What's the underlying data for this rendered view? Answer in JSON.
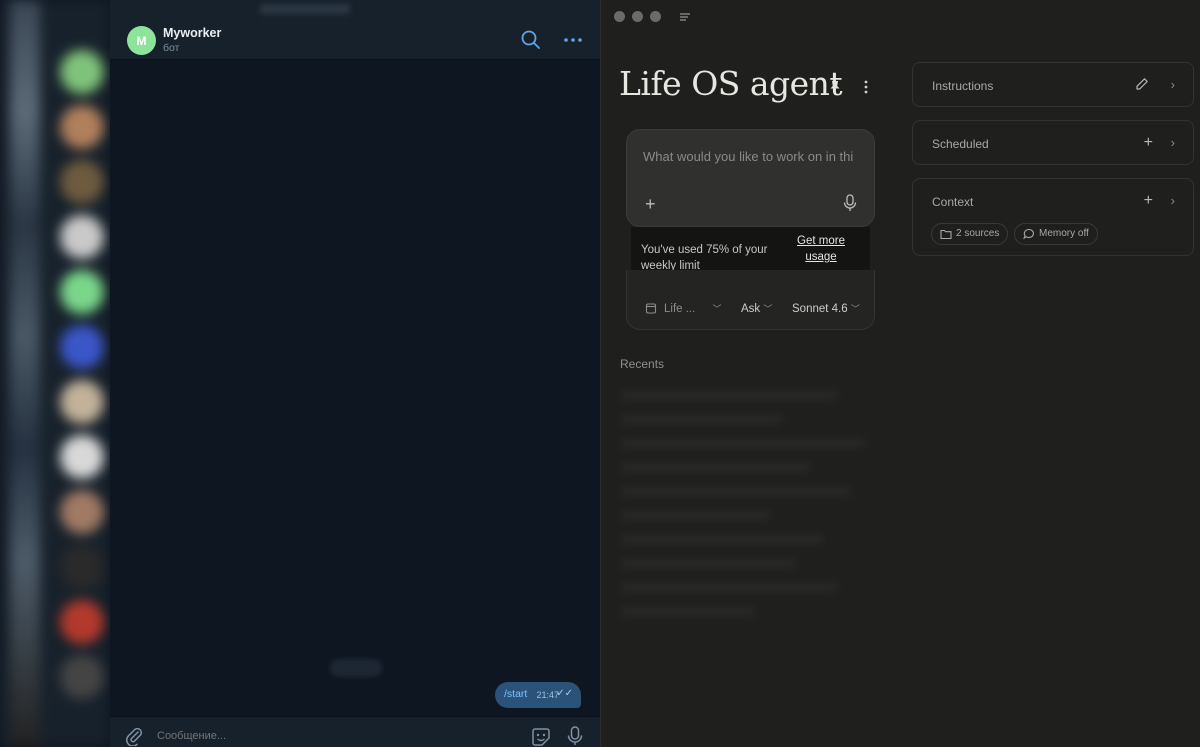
{
  "telegram": {
    "chat_name": "Myworker",
    "chat_subtitle": "бот",
    "avatar_letter": "M",
    "avatar_color": "#8ee39b",
    "message_text": "/start",
    "message_time": "21:47",
    "composer_placeholder": "Сообщение..."
  },
  "claude": {
    "title": "Life OS agent",
    "composer_placeholder": "What would you like to work on in thi",
    "limit_message": "You've used 75% of your weekly limit",
    "get_more_label": "Get more usage",
    "project_label": "Life ...",
    "mode_label": "Ask",
    "model_label": "Sonnet 4.6",
    "recents_label": "Recents",
    "panels": {
      "instructions": "Instructions",
      "scheduled": "Scheduled",
      "context": "Context"
    },
    "chips": {
      "sources": "2 sources",
      "memory": "Memory off"
    }
  }
}
